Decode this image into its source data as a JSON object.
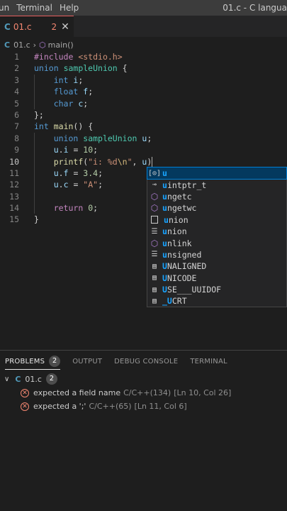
{
  "menubar": {
    "items": [
      "un",
      "Terminal",
      "Help"
    ],
    "window_title": "01.c - C langua"
  },
  "tabs": [
    {
      "icon": "C",
      "label": "01.c",
      "count": "2",
      "close": "✕"
    }
  ],
  "breadcrumb": {
    "file_icon": "C",
    "file": "01.c",
    "separator": "›",
    "symbol": "main()"
  },
  "editor": {
    "line_numbers": [
      "1",
      "2",
      "3",
      "4",
      "5",
      "6",
      "7",
      "8",
      "9",
      "10",
      "11",
      "12",
      "13",
      "14",
      "15"
    ],
    "current_line": "10"
  },
  "suggest": {
    "items": [
      {
        "icon": "variable-icon",
        "match": "u",
        "rest": ""
      },
      {
        "icon": "typedef-icon",
        "match": "u",
        "rest": "intptr_t"
      },
      {
        "icon": "function-icon",
        "match": "u",
        "rest": "ngetc"
      },
      {
        "icon": "function-icon",
        "match": "u",
        "rest": "ngetwc"
      },
      {
        "icon": "snippet-icon",
        "match": "u",
        "rest": "nion"
      },
      {
        "icon": "keyword-icon",
        "match": "u",
        "rest": "nion"
      },
      {
        "icon": "function-icon",
        "match": "u",
        "rest": "nlink"
      },
      {
        "icon": "keyword-icon",
        "match": "u",
        "rest": "nsigned"
      },
      {
        "icon": "macro-icon",
        "match": "U",
        "rest": "NALIGNED"
      },
      {
        "icon": "macro-icon",
        "match": "U",
        "rest": "NICODE"
      },
      {
        "icon": "macro-icon",
        "match": "U",
        "rest": "SE___UUIDOF"
      },
      {
        "icon": "macro-icon",
        "match": "_U",
        "rest": "CRT"
      }
    ]
  },
  "panel": {
    "tabs": [
      {
        "label": "PROBLEMS",
        "badge": "2"
      },
      {
        "label": "OUTPUT"
      },
      {
        "label": "DEBUG CONSOLE"
      },
      {
        "label": "TERMINAL"
      }
    ],
    "file": {
      "chevron": "∨",
      "icon": "C",
      "name": "01.c",
      "count": "2"
    },
    "problems": [
      {
        "message": "expected a field name",
        "source": "C/C++(134)",
        "location": "[Ln 10, Col 26]"
      },
      {
        "message": "expected a ';'",
        "source": "C/C++(65)",
        "location": "[Ln 11, Col 6]"
      }
    ]
  }
}
